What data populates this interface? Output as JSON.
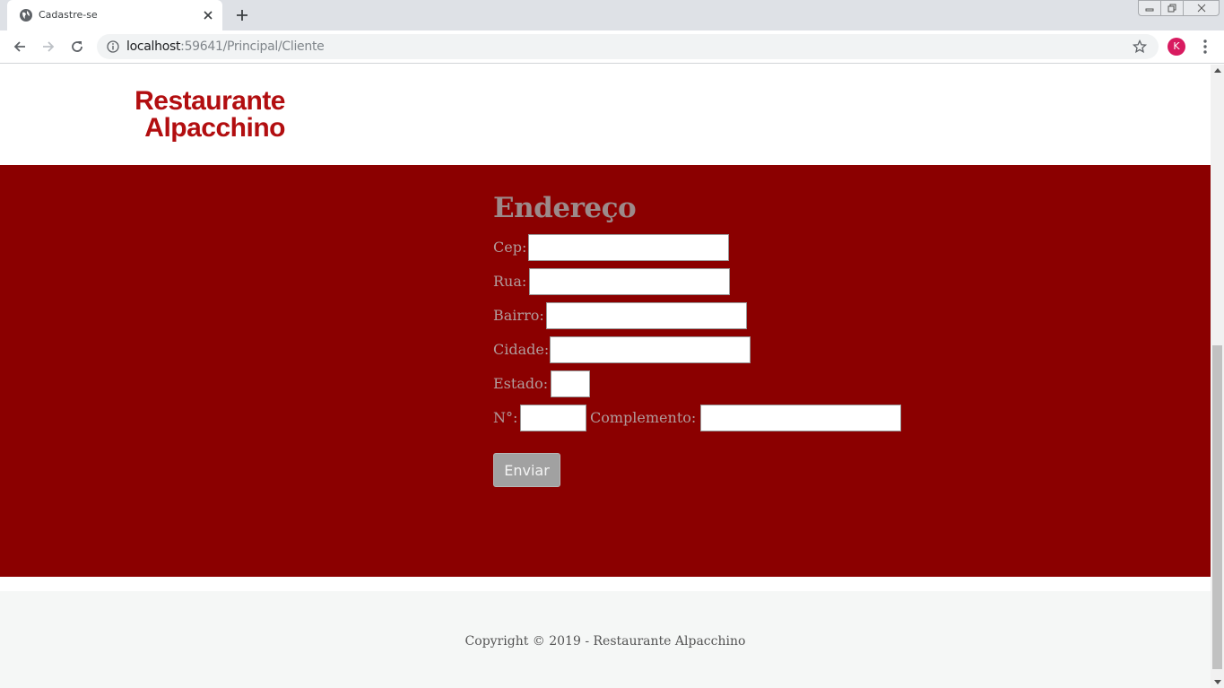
{
  "browser": {
    "tab_title": "Cadastre-se",
    "url_host": "localhost",
    "url_rest": ":59641/Principal/Cliente",
    "avatar_letter": "K"
  },
  "brand": {
    "line1": "Restaurante",
    "line2": "Alpacchino",
    "color": "#b20e10"
  },
  "form": {
    "title": "Endereço",
    "fields": {
      "cep": {
        "label": "Cep:",
        "value": ""
      },
      "rua": {
        "label": "Rua:",
        "value": ""
      },
      "bairro": {
        "label": "Bairro:",
        "value": ""
      },
      "cidade": {
        "label": "Cidade:",
        "value": ""
      },
      "estado": {
        "label": "Estado:",
        "value": ""
      },
      "numero": {
        "label": "N°:",
        "value": ""
      },
      "complemento": {
        "label": "Complemento:",
        "value": ""
      }
    },
    "submit_label": "Enviar"
  },
  "footer": {
    "copyright": "Copyright © 2019 - Restaurante Alpacchino"
  },
  "colors": {
    "hero_background": "#8b0000",
    "footer_background": "#f5f7f6"
  }
}
